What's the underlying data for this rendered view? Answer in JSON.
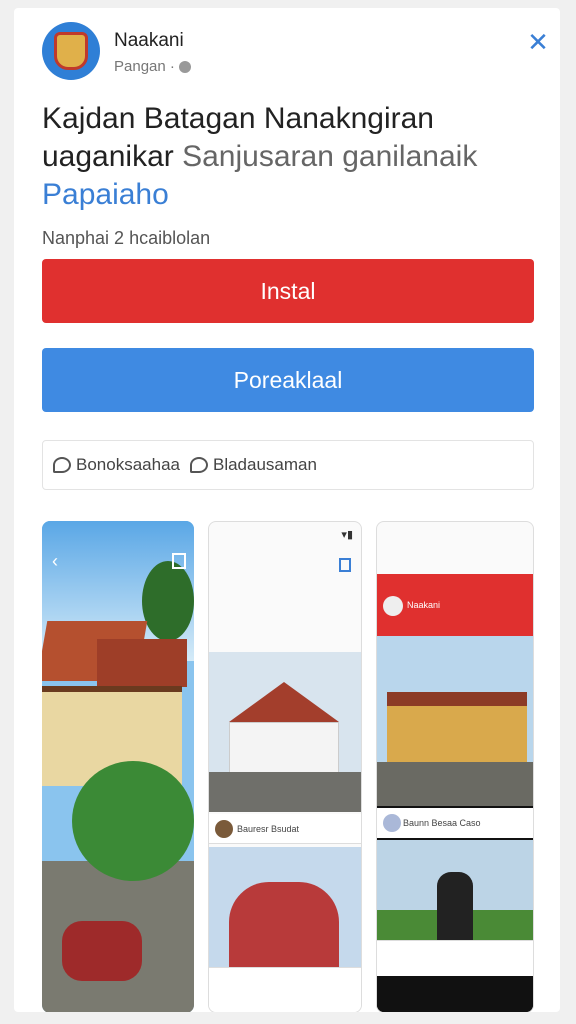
{
  "header": {
    "app_name": "Naakani",
    "app_sub": "Pangan ·",
    "close_symbol": "✕"
  },
  "title": {
    "line1": "Kajdan Batagan Nanakngiran",
    "line2_a": "uaganikar",
    "line2_b": "Sanjusaran ganilanaik",
    "line3": "Papaiaho"
  },
  "meta": "Nanphai  2 hcaiblolan",
  "buttons": {
    "install": "Instal",
    "secondary": "Poreaklaal"
  },
  "tags": [
    {
      "label": "Bonoksaahaa",
      "icon": "chat-bubble-icon"
    },
    {
      "label": "Bladausaman",
      "icon": "chat-bubble-icon"
    }
  ],
  "screenshots": {
    "shot2_row": "Bauresr Bsudat",
    "shot3_bar": "Naakani",
    "shot3_row": "Baunn Besaa Caso"
  },
  "colors": {
    "install": "#e0302f",
    "secondary": "#3f8ae2",
    "accent": "#3a7fd5"
  }
}
